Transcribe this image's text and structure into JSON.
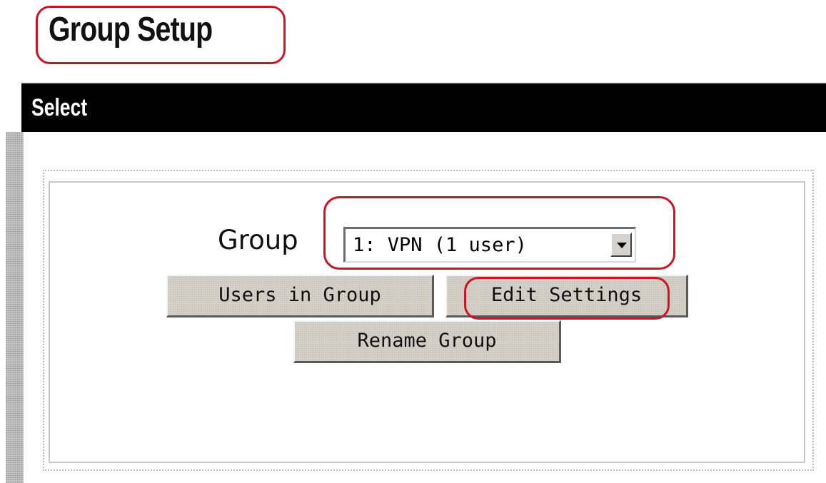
{
  "page": {
    "title": "Group Setup"
  },
  "header": {
    "label": "Select"
  },
  "form": {
    "group_label": "Group",
    "group_select": {
      "selected": "1: VPN (1 user)"
    }
  },
  "buttons": {
    "users_in_group": "Users in Group",
    "edit_settings": "Edit Settings",
    "rename_group": "Rename Group"
  },
  "colors": {
    "annotation": "#cc1522",
    "header_background": "#000000",
    "button_face": "#d4d0c8"
  }
}
